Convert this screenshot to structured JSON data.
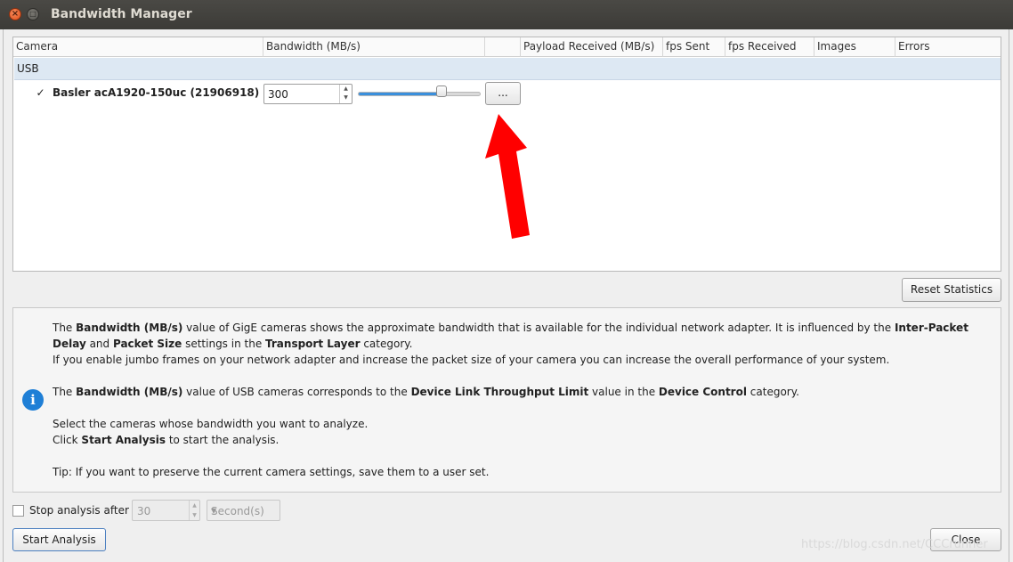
{
  "window": {
    "title": "Bandwidth Manager"
  },
  "table": {
    "columns": [
      "Camera",
      "Bandwidth (MB/s)",
      "",
      "Payload Received (MB/s)",
      "fps Sent",
      "fps Received",
      "Images",
      "Errors"
    ],
    "group": "USB",
    "camera": {
      "name": "Basler acA1920-150uc (21906918)",
      "checked": true,
      "bandwidth": "300",
      "slider_fraction": 0.68,
      "more_button": "..."
    }
  },
  "reset_button": "Reset Statistics",
  "info": {
    "p1_pre": "The ",
    "p1_b1": "Bandwidth (MB/s)",
    "p1_mid1": " value of GigE cameras shows the approximate bandwidth that is available for the individual network adapter. It is influenced by the ",
    "p1_b2": "Inter-Packet Delay",
    "p1_mid2": " and ",
    "p1_b3": "Packet Size",
    "p1_mid3": " settings in the ",
    "p1_b4": "Transport Layer",
    "p1_end": " category.",
    "p2": "If you enable jumbo frames on your network adapter and increase the packet size of your camera you can increase the overall performance of your system.",
    "p3_pre": "The ",
    "p3_b1": "Bandwidth (MB/s)",
    "p3_mid1": " value of USB cameras corresponds to the ",
    "p3_b2": "Device Link Throughput Limit",
    "p3_mid2": " value in the ",
    "p3_b3": "Device Control",
    "p3_end": " category.",
    "p4": "Select the cameras whose bandwidth you want to analyze.",
    "p5_pre": "Click ",
    "p5_b": "Start Analysis",
    "p5_end": " to start the analysis.",
    "p6": "Tip: If you want to preserve the current camera settings, save them to a user set."
  },
  "stop": {
    "label": "Stop analysis after",
    "value": "30",
    "unit": "Second(s)",
    "checked": false
  },
  "start_button": "Start Analysis",
  "close_button": "Close",
  "watermark": "https://blog.csdn.net/CCCrunner",
  "colors": {
    "accent": "#3a8fdc",
    "arrow": "#ff0000",
    "group_bg": "#dde8f3"
  }
}
